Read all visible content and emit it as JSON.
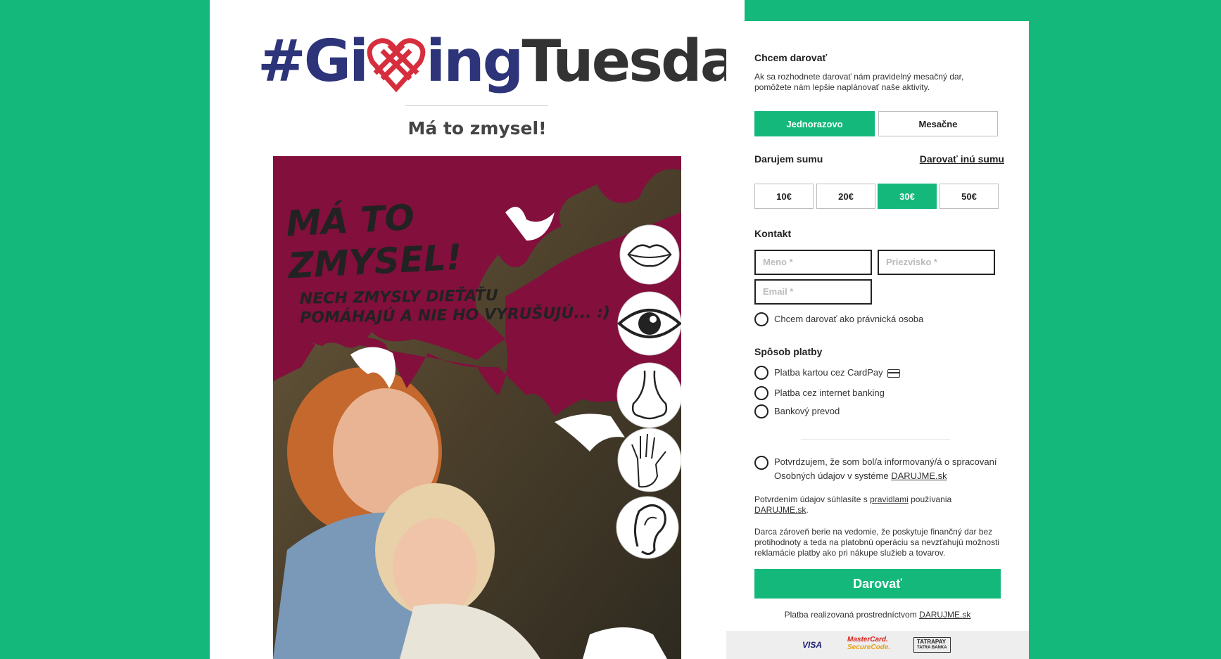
{
  "logo": {
    "part1": "#Gi",
    "part2": "ing",
    "part3": "Tuesday"
  },
  "subtitle": "Má to zmysel!",
  "poster": {
    "title": "MÁ TO\nZMYSEL!",
    "subtitle": "NECH ZMYSLY DIEŤAŤU\nPOMÁHAJÚ A NIE HO VYRUŠUJÚ... :)",
    "sense_icons": [
      "lips-icon",
      "eye-icon",
      "nose-icon",
      "hand-icon",
      "ear-icon"
    ]
  },
  "form": {
    "donate_title": "Chcem darovať",
    "donate_desc": "Ak sa rozhodnete darovať nám pravidelný mesačný dar, pomôžete nám lepšie naplánovať naše aktivity.",
    "frequency": {
      "once": "Jednorazovo",
      "monthly": "Mesačne",
      "selected": "once"
    },
    "amount_title": "Darujem sumu",
    "other_amount": "Darovať inú sumu",
    "amounts": [
      "10€",
      "20€",
      "30€",
      "50€"
    ],
    "selected_amount": "30€",
    "contact_title": "Kontakt",
    "first_name_placeholder": "Meno *",
    "last_name_placeholder": "Priezvisko *",
    "email_placeholder": "Email *",
    "legal_person": "Chcem darovať ako právnická osoba",
    "payment_title": "Spôsob platby",
    "payment_methods": [
      "Platba kartou cez CardPay",
      "Platba cez internet banking",
      "Bankový prevod"
    ],
    "consent_part1": "Potvrdzujem, že som bol/a informovaný/á o spracovaní Osobných údajov v systéme ",
    "consent_link": "DARUJME.sk",
    "terms_part1": "Potvrdením údajov súhlasíte s ",
    "terms_link1": "pravidlami",
    "terms_part2": " používania ",
    "terms_link2": "DARUJME.sk",
    "terms_part3": ".",
    "disclaimer": "Darca zároveň berie na vedomie, že poskytuje finančný dar bez protihodnoty a teda na platobnú operáciu sa nevzťahujú možnosti reklamácie platby ako pri nákupe služieb a tovarov.",
    "submit": "Darovať",
    "footer_part1": "Platba realizovaná prostredníctvom ",
    "footer_link": "DARUJME.sk",
    "pay_logos": {
      "visa": "VISA",
      "mc1": "MasterCard.",
      "mc2": "SecureCode.",
      "tatra1": "TATRAPAY",
      "tatra2": "TATRA BANKA"
    }
  },
  "colors": {
    "brand_green": "#14b87b",
    "poster_maroon": "#820f3c",
    "logo_navy": "#2d3479",
    "logo_red": "#d62e3d"
  }
}
